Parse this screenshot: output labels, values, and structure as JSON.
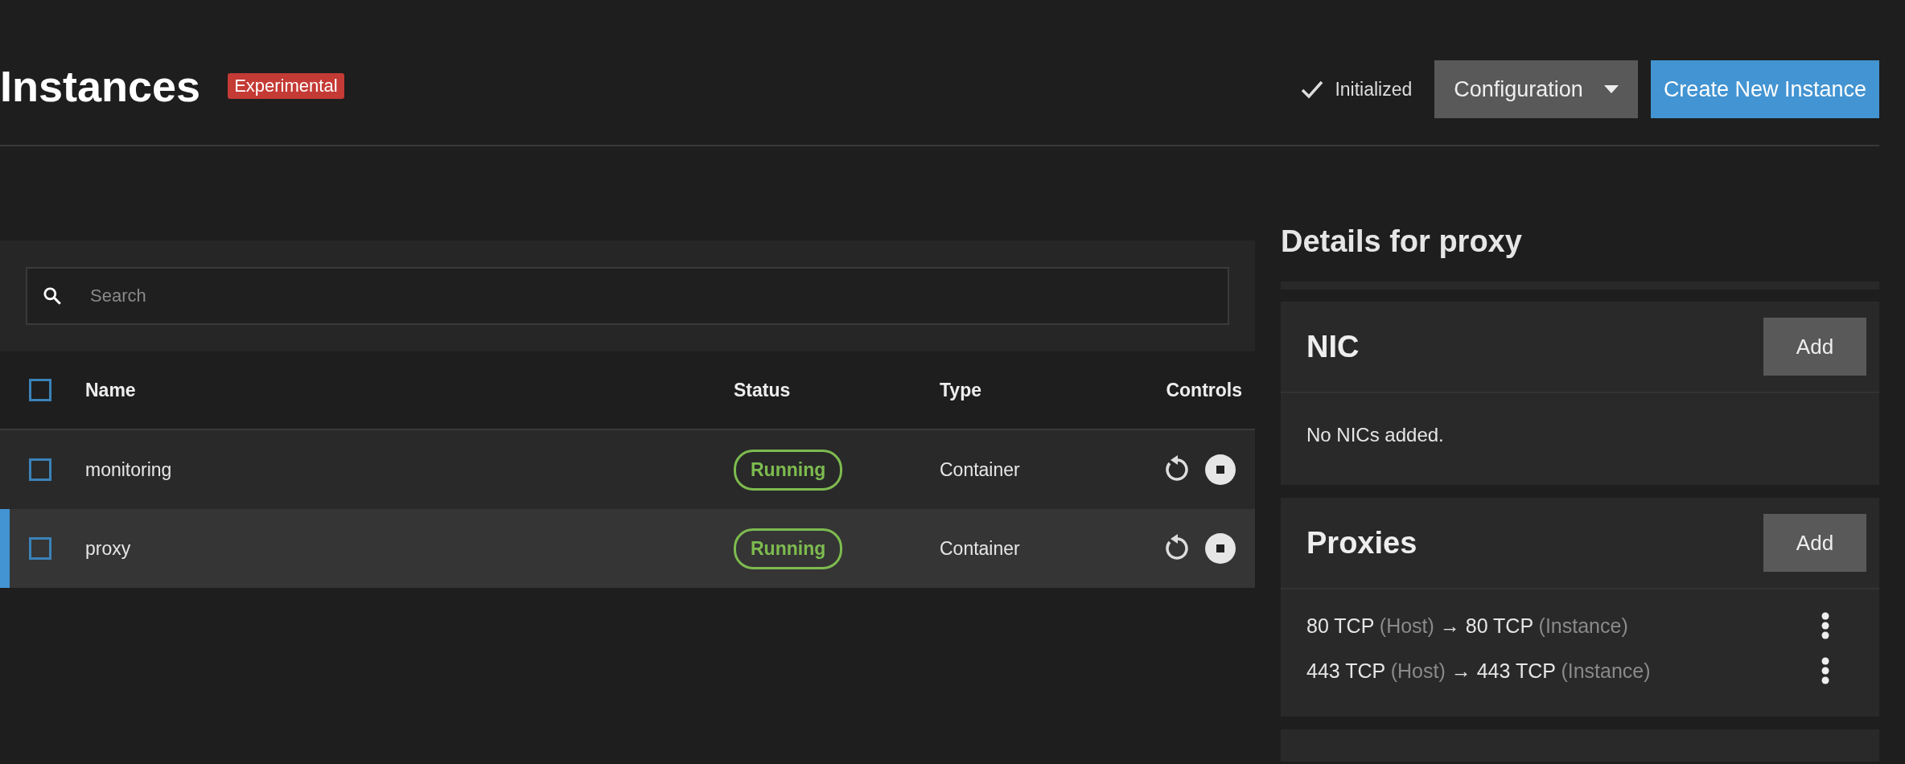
{
  "header": {
    "title": "Instances",
    "badge": "Experimental",
    "status": {
      "label": "Initialized",
      "checked": true
    },
    "config_button": "Configuration",
    "create_button": "Create New Instance"
  },
  "search": {
    "placeholder": "Search"
  },
  "table": {
    "select_all": {
      "checked": false
    },
    "columns": [
      "Name",
      "Status",
      "Type",
      "Controls"
    ],
    "rows": [
      {
        "name": "monitoring",
        "status": "Running",
        "color": "#7dbb4f",
        "type": "Container",
        "checked": false,
        "selected": false
      },
      {
        "name": "proxy",
        "status": "Running",
        "color": "#7dbb4f",
        "type": "Container",
        "checked": false,
        "selected": true
      }
    ]
  },
  "details": {
    "title": "Details for proxy",
    "cards": [
      {
        "kind": "empty",
        "title": "NIC",
        "add_button": "Add",
        "message": "No NICs added."
      },
      {
        "kind": "list",
        "title": "Proxies",
        "add_button": "Add",
        "items": [
          {
            "host_port": "80 TCP",
            "host_label": "(Host)",
            "arrow": "→",
            "instance_port": "80 TCP",
            "instance_label": "(Instance)"
          },
          {
            "host_port": "443 TCP",
            "host_label": "(Host)",
            "arrow": "→",
            "instance_port": "443 TCP",
            "instance_label": "(Instance)"
          }
        ]
      }
    ]
  }
}
